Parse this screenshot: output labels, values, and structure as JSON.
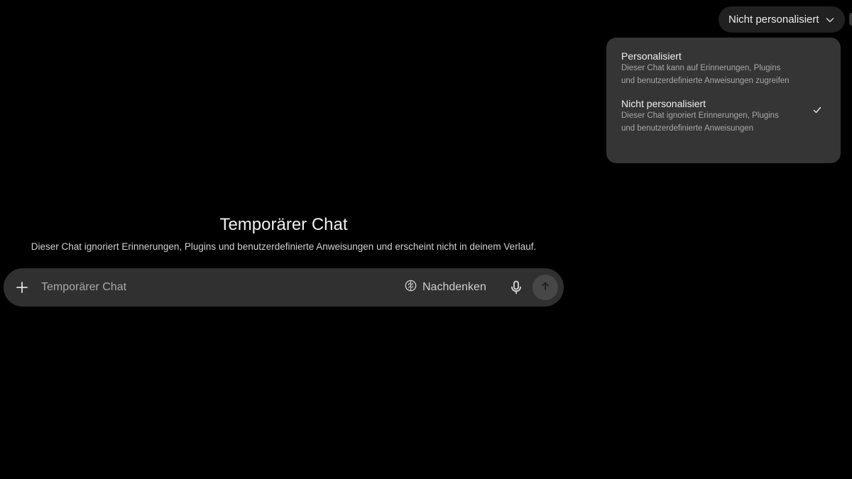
{
  "header": {
    "mode_selector": {
      "label": "Nicht personalisiert",
      "icon": "chevron-down-icon"
    }
  },
  "mode_menu": {
    "items": [
      {
        "title": "Personalisiert",
        "description": "Dieser Chat kann auf Erinnerungen, Plugins und benutzerdefinierte Anweisungen zugreifen",
        "selected": false
      },
      {
        "title": "Nicht personalisiert",
        "description": "Dieser Chat ignoriert Erinnerungen, Plugins und benutzerdefinierte Anweisungen",
        "selected": true
      }
    ],
    "selected_icon": "checkmark-icon"
  },
  "main": {
    "title": "Temporärer Chat",
    "subtitle": "Dieser Chat ignoriert Erinnerungen, Plugins und benutzerdefinierte Anweisungen und erscheint nicht in deinem Verlauf."
  },
  "composer": {
    "placeholder": "Temporärer Chat",
    "value": "",
    "think_label": "Nachdenken",
    "icons": {
      "attach": "plus-icon",
      "think": "brain-icon",
      "voice": "microphone-icon",
      "send": "arrow-up-icon"
    }
  },
  "colors": {
    "background": "#000000",
    "menu_background": "#353535",
    "composer_background": "#303030",
    "send_button": "#474747",
    "text_primary": "#ececec",
    "text_secondary": "#a8a8a8"
  }
}
